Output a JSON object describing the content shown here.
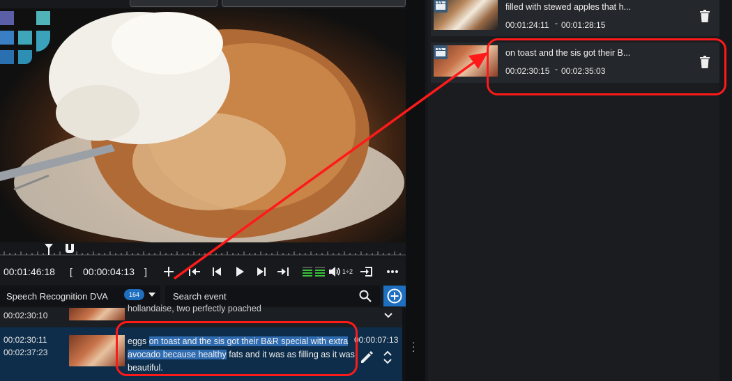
{
  "player": {
    "current_time": "00:01:46:18",
    "bracket_left": "[",
    "duration": "00:00:04:13",
    "bracket_right": "]",
    "rate_label": "1÷2"
  },
  "search_row": {
    "dropdown_label": "Speech Recognition DVA",
    "count_badge": "164",
    "search_placeholder": "Search event"
  },
  "transcript": {
    "partial_row": {
      "time_in": "00:02:30:10",
      "text": "hollandaise, two perfectly poached"
    },
    "selected_row": {
      "time_in": "00:02:30:11",
      "time_out": "00:02:37:23",
      "duration": "00:00:07:13",
      "text_pre": "eggs ",
      "text_highlight": "on toast and the sis got their B&R special with extra avocado because healthy",
      "text_post": " fats and it was as filling as it was beautiful."
    }
  },
  "events": [
    {
      "title": "filled with stewed apples that h...",
      "time_in": "00:01:24:11",
      "separator": "-",
      "time_out": "00:01:28:15"
    },
    {
      "title": "on toast and the sis got their B...",
      "time_in": "00:02:30:15",
      "separator": "-",
      "time_out": "00:02:35:03"
    }
  ],
  "colors": {
    "accent": "#1f6fc0",
    "annotation": "#ff1a1a",
    "selection": "#2f6bb0"
  }
}
